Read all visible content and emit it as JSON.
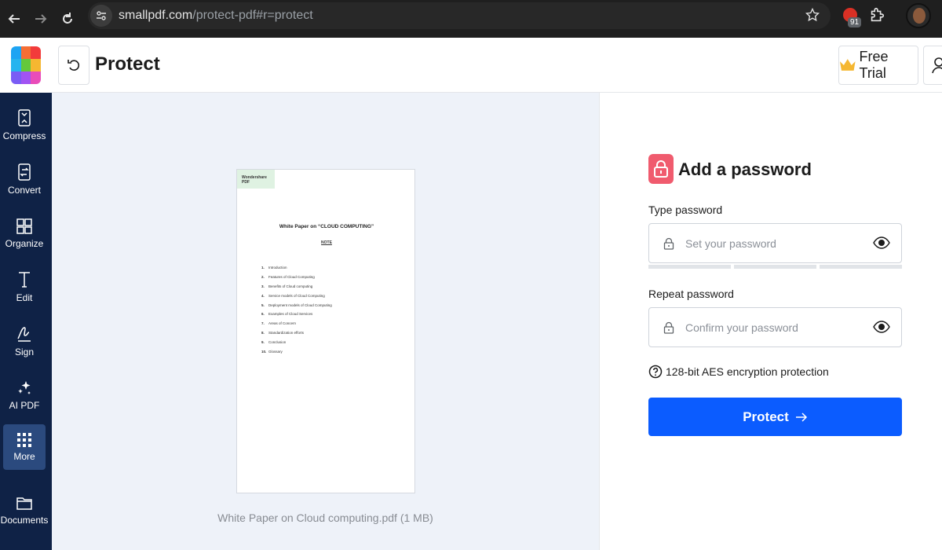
{
  "browser": {
    "url_domain": "smallpdf.com",
    "url_path": "/protect-pdf#r=protect",
    "extension_badge": "91",
    "icons": [
      "back-icon",
      "forward-icon",
      "reload-icon",
      "site-info-icon",
      "star-icon",
      "pdf-extension-icon",
      "puzzle-icon",
      "avatar"
    ]
  },
  "header": {
    "title": "Protect",
    "free_trial_label": "Free Trial"
  },
  "sidebar": {
    "items": [
      {
        "label": "Compress",
        "icon": "compress-icon"
      },
      {
        "label": "Convert",
        "icon": "convert-icon"
      },
      {
        "label": "Organize",
        "icon": "organize-icon"
      },
      {
        "label": "Edit",
        "icon": "edit-icon"
      },
      {
        "label": "Sign",
        "icon": "sign-icon"
      },
      {
        "label": "AI PDF",
        "icon": "sparkle-icon"
      },
      {
        "label": "More",
        "icon": "grid-icon"
      },
      {
        "label": "Documents",
        "icon": "folder-icon"
      }
    ],
    "active": "More"
  },
  "preview": {
    "thumb_watermark": "Wondershare PDF",
    "thumb_title": "White Paper on “CLOUD COMPUTING”",
    "thumb_subtitle": "NOTE",
    "toc": [
      {
        "n": "1.",
        "t": "Introduction"
      },
      {
        "n": "2.",
        "t": "Features of Cloud Computing"
      },
      {
        "n": "3.",
        "t": "Benefits of Cloud computing"
      },
      {
        "n": "4.",
        "t": "Service models of Cloud Computing"
      },
      {
        "n": "5.",
        "t": "Deployment models of Cloud Computing"
      },
      {
        "n": "6.",
        "t": "Examples of Cloud Services"
      },
      {
        "n": "7.",
        "t": "Areas of Concern"
      },
      {
        "n": "8.",
        "t": "Standardization efforts"
      },
      {
        "n": "9.",
        "t": "Conclusion"
      },
      {
        "n": "10.",
        "t": "Glossary"
      }
    ],
    "file_caption": "White Paper on Cloud computing.pdf (1 MB)"
  },
  "form": {
    "heading": "Add a password",
    "type_label": "Type password",
    "type_placeholder": "Set your password",
    "repeat_label": "Repeat password",
    "repeat_placeholder": "Confirm your password",
    "aes_text": "128-bit AES encryption protection",
    "protect_label": "Protect",
    "colors": {
      "primary": "#0b5cff",
      "lock_badge": "#f05b6e",
      "sidebar": "#0f2246"
    }
  }
}
